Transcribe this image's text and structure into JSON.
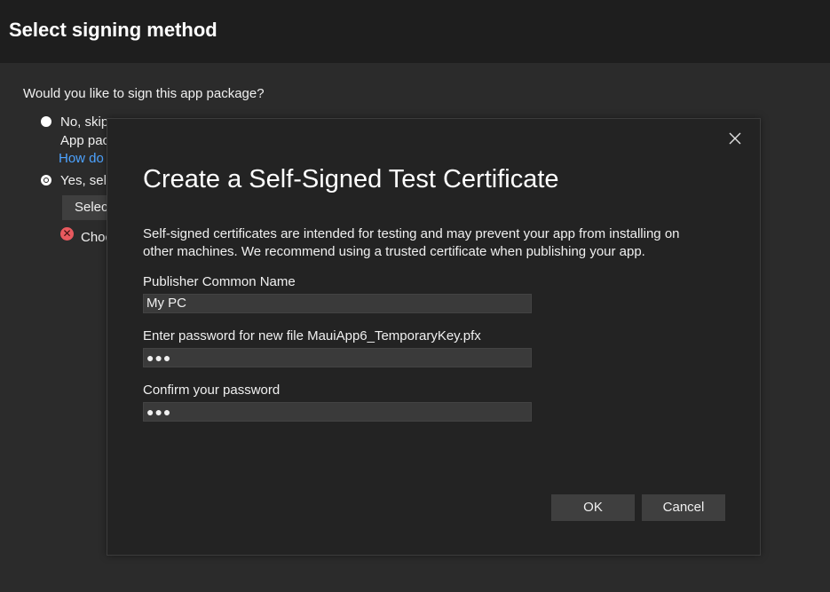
{
  "header": {
    "title": "Select signing method"
  },
  "background": {
    "question": "Would you like to sign this app package?",
    "option_no_line1": "No, skip",
    "option_no_line2": "App pac",
    "option_no_link": "How do",
    "option_yes": "Yes, sele",
    "select_button": "Select",
    "error_text": "Choc"
  },
  "dialog": {
    "title": "Create a Self-Signed Test Certificate",
    "description": "Self-signed certificates are intended for testing and may prevent your app from installing on other machines. We recommend using a trusted certificate when publishing your app.",
    "publisher_label": "Publisher Common Name",
    "publisher_value": "My PC",
    "password_label": "Enter password for new file MauiApp6_TemporaryKey.pfx",
    "password_value": "●●●",
    "confirm_label": "Confirm your password",
    "confirm_value": "●●●",
    "ok_label": "OK",
    "cancel_label": "Cancel"
  },
  "colors": {
    "header_bg": "#1e1e1e",
    "page_bg": "#2b2b2b",
    "dialog_bg": "#232323",
    "link": "#4da3ff",
    "error": "#e8595e"
  }
}
